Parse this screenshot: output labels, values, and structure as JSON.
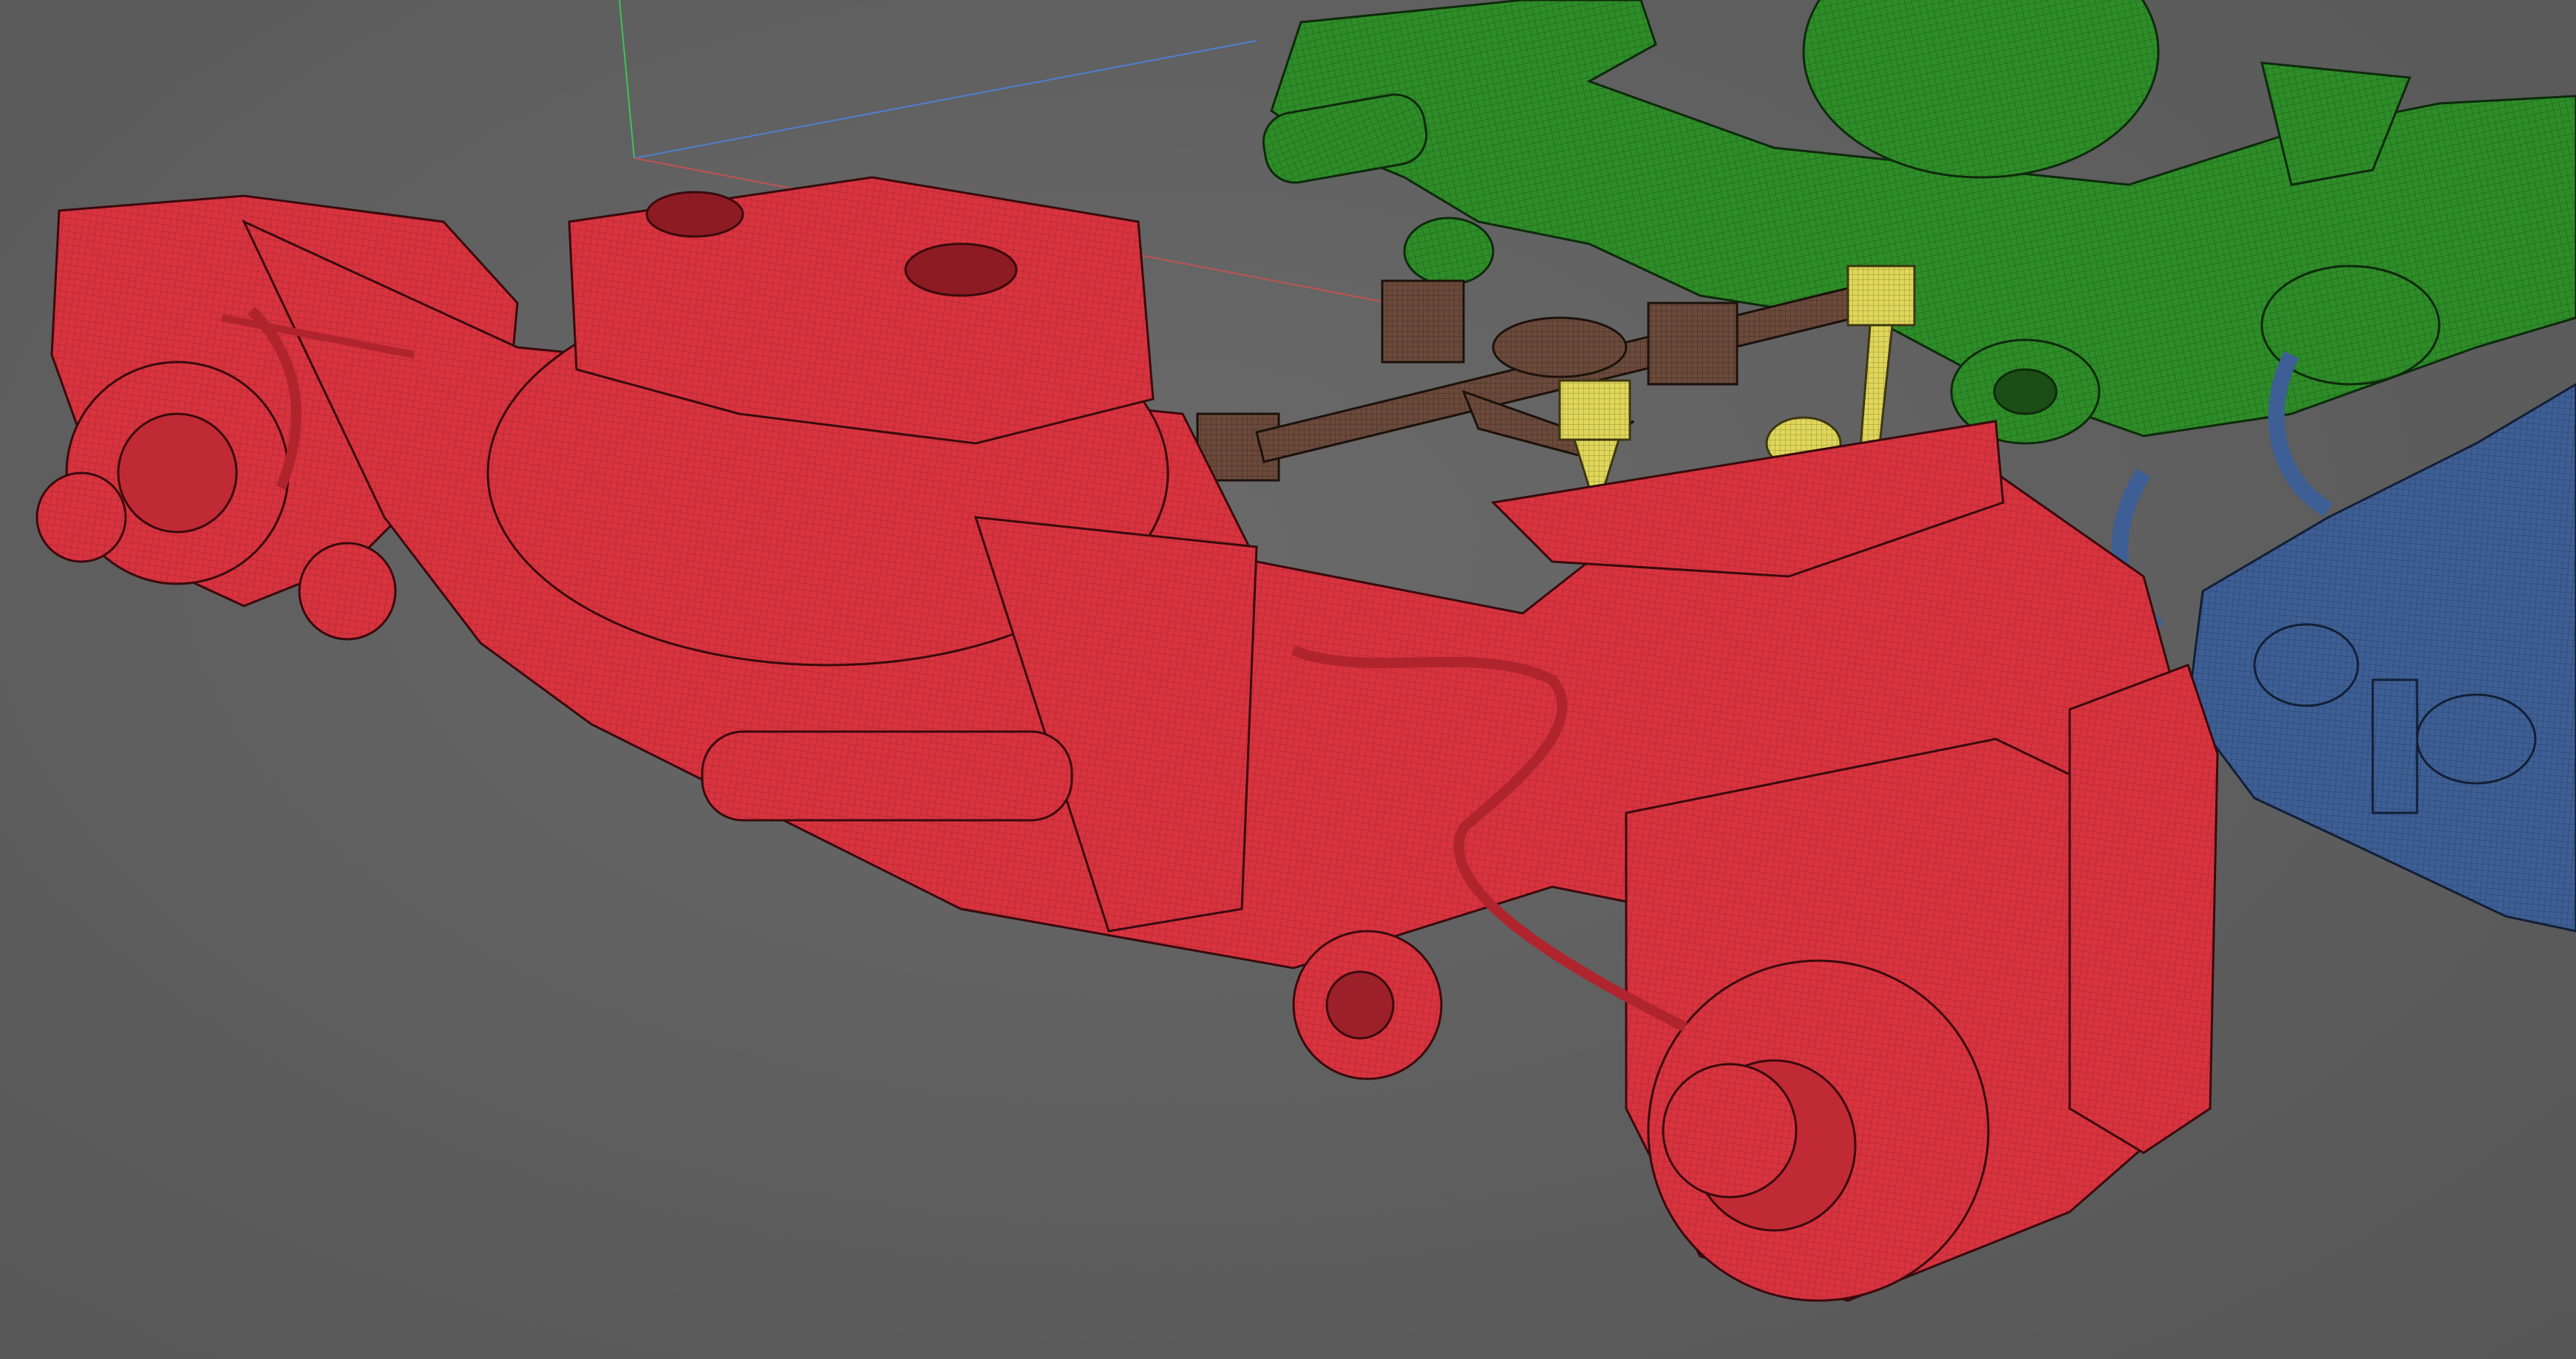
{
  "viewport": {
    "background": "#5f5f5f",
    "axes": {
      "x_color": "#d05050",
      "y_color": "#3cc35a",
      "z_color": "#4f7fd0"
    }
  },
  "scene": {
    "objects": [
      {
        "name": "red-bogie-frame",
        "color": "#d8333f"
      },
      {
        "name": "green-bogie-frame",
        "color": "#2e8d28"
      },
      {
        "name": "blue-axle-assembly",
        "color": "#3e5f95"
      },
      {
        "name": "brown-brake-linkage",
        "color": "#6b4a3b"
      },
      {
        "name": "yellow-linkage-parts",
        "color": "#e0d65a"
      }
    ]
  }
}
